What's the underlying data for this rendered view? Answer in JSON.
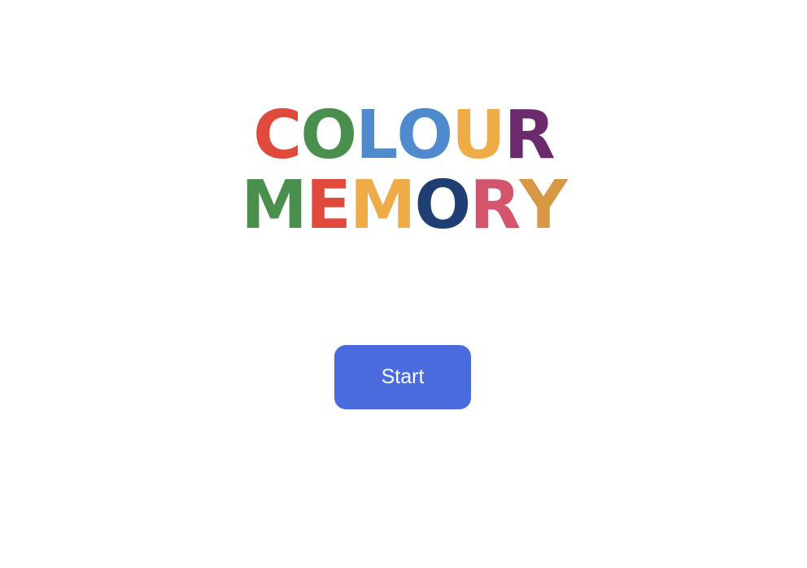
{
  "title": {
    "line1": [
      {
        "char": "C",
        "color": "#e04a3c"
      },
      {
        "char": "O",
        "color": "#4a8f4d"
      },
      {
        "char": "L",
        "color": "#4f8bcc"
      },
      {
        "char": "O",
        "color": "#4f8bcc"
      },
      {
        "char": "U",
        "color": "#efab45"
      },
      {
        "char": "R",
        "color": "#6a2a6c"
      }
    ],
    "line2": [
      {
        "char": "M",
        "color": "#4a8f4d"
      },
      {
        "char": "E",
        "color": "#e04a3c"
      },
      {
        "char": "M",
        "color": "#efab45"
      },
      {
        "char": "O",
        "color": "#1f3f74"
      },
      {
        "char": "R",
        "color": "#d4566e"
      },
      {
        "char": "Y",
        "color": "#d79845"
      }
    ]
  },
  "start_button": {
    "label": "Start",
    "color": "#4a6bde"
  }
}
